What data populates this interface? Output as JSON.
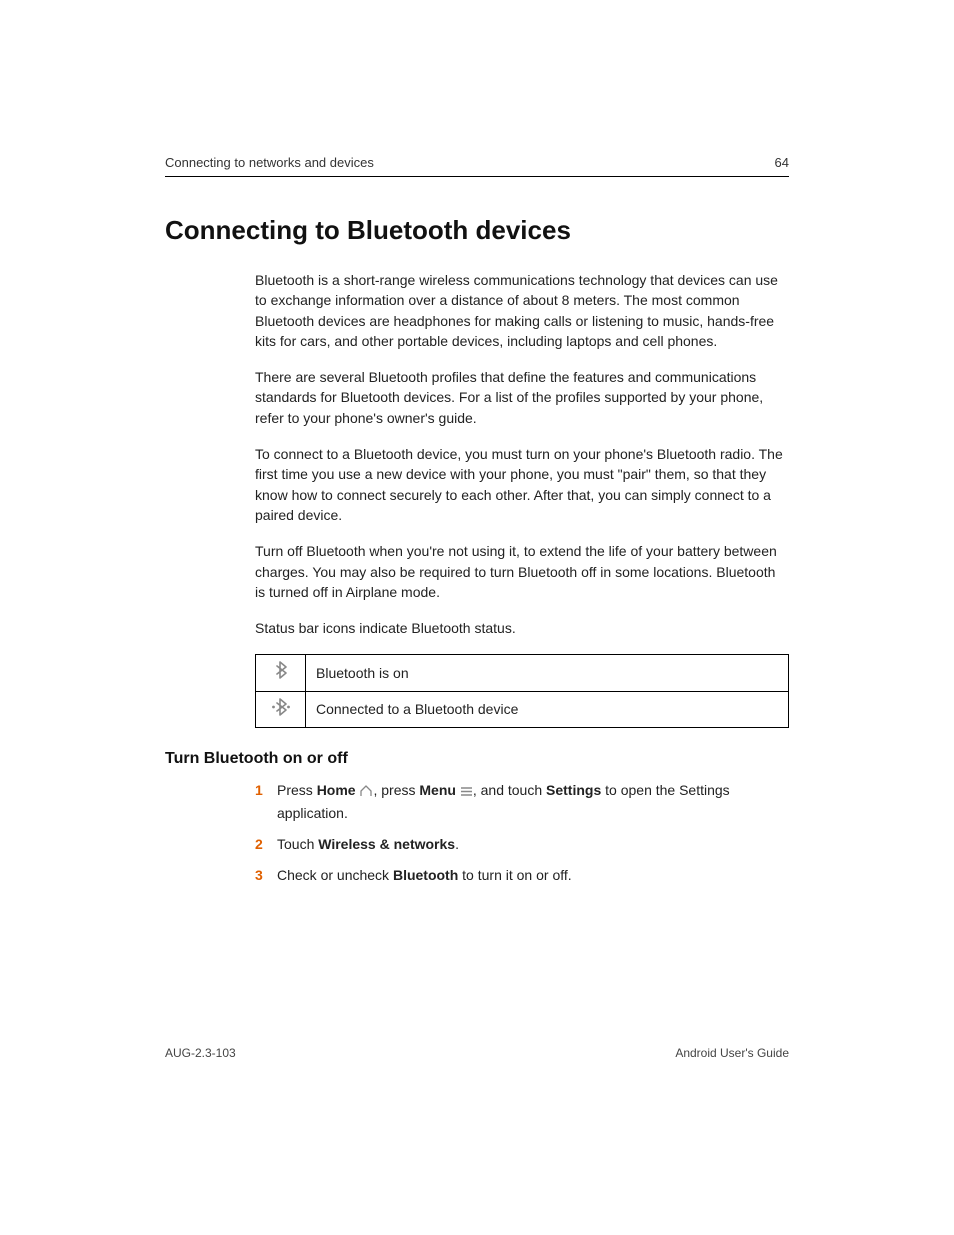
{
  "header": {
    "section": "Connecting to networks and devices",
    "page_number": "64"
  },
  "title": "Connecting to Bluetooth devices",
  "paragraphs": {
    "p1": "Bluetooth is a short-range wireless communications technology that devices can use to exchange information over a distance of about 8 meters. The most common Bluetooth devices are headphones for making calls or listening to music, hands-free kits for cars, and other portable devices, including laptops and cell phones.",
    "p2": "There are several Bluetooth profiles that define the features and communications standards for Bluetooth devices. For a list of the profiles supported by your phone, refer to your phone's owner's guide.",
    "p3": "To connect to a Bluetooth device, you must turn on your phone's Bluetooth radio. The first time you use a new device with your phone, you must \"pair\" them, so that they know how to connect securely to each other. After that, you can simply connect to a paired device.",
    "p4": "Turn off Bluetooth when you're not using it, to extend the life of your battery between charges. You may also be required to turn Bluetooth off in some locations. Bluetooth is turned off in Airplane mode.",
    "p5": "Status bar icons indicate Bluetooth status."
  },
  "table": {
    "row1": "Bluetooth is on",
    "row2": "Connected to a Bluetooth device"
  },
  "subhead": "Turn Bluetooth on or off",
  "steps": {
    "s1": {
      "num": "1",
      "pre": "Press ",
      "b1": "Home",
      "mid1": " ",
      "mid2": ", press ",
      "b2": "Menu",
      "mid3": " ",
      "mid4": ", and touch ",
      "b3": "Settings",
      "post": " to open the Settings application."
    },
    "s2": {
      "num": "2",
      "pre": "Touch ",
      "b1": "Wireless & networks",
      "post": "."
    },
    "s3": {
      "num": "3",
      "pre": "Check or uncheck ",
      "b1": "Bluetooth",
      "post": " to turn it on or off."
    }
  },
  "footer": {
    "left": "AUG-2.3-103",
    "right": "Android User's Guide"
  }
}
